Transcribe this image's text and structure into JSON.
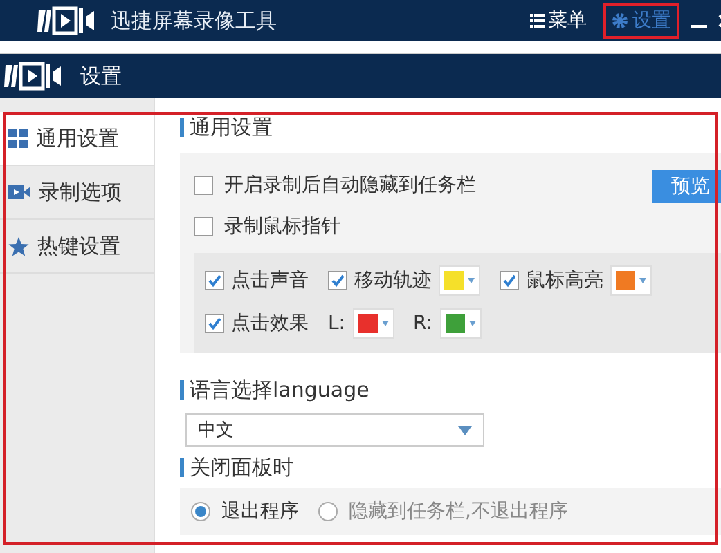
{
  "app": {
    "title": "迅捷屏幕录像工具",
    "menu_label": "菜单",
    "settings_label": "设置",
    "settings_highlighted": true
  },
  "dialog": {
    "title": "设置",
    "highlighted": true
  },
  "sidebar": {
    "items": [
      {
        "kind": "general",
        "label": "通用设置",
        "selected": true
      },
      {
        "kind": "recording",
        "label": "录制选项",
        "selected": false
      },
      {
        "kind": "hotkeys",
        "label": "热键设置",
        "selected": false
      }
    ]
  },
  "general": {
    "heading": "通用设置",
    "preview_button": "预览",
    "options": [
      {
        "label": "开启录制后自动隐藏到任务栏",
        "checked": false
      },
      {
        "label": "录制鼠标指针",
        "checked": false
      }
    ],
    "pointer_effects": [
      [
        {
          "kind": "check",
          "label": "点击声音",
          "checked": true
        },
        {
          "kind": "check_color",
          "label": "移动轨迹",
          "checked": true,
          "color": "#f5e02a"
        },
        {
          "kind": "check_color",
          "label": "鼠标高亮",
          "checked": true,
          "color": "#f07a22"
        }
      ],
      [
        {
          "kind": "check",
          "label": "点击效果",
          "checked": true
        },
        {
          "kind": "color",
          "label": "L:",
          "color": "#e8302c"
        },
        {
          "kind": "color",
          "label": "R:",
          "color": "#3ea03a"
        }
      ]
    ]
  },
  "language": {
    "heading": "语言选择language",
    "value": "中文"
  },
  "close_panel": {
    "heading": "关闭面板时",
    "options": [
      {
        "label": "退出程序",
        "selected": true
      },
      {
        "label": "隐藏到任务栏,不退出程序",
        "selected": false
      }
    ]
  }
}
